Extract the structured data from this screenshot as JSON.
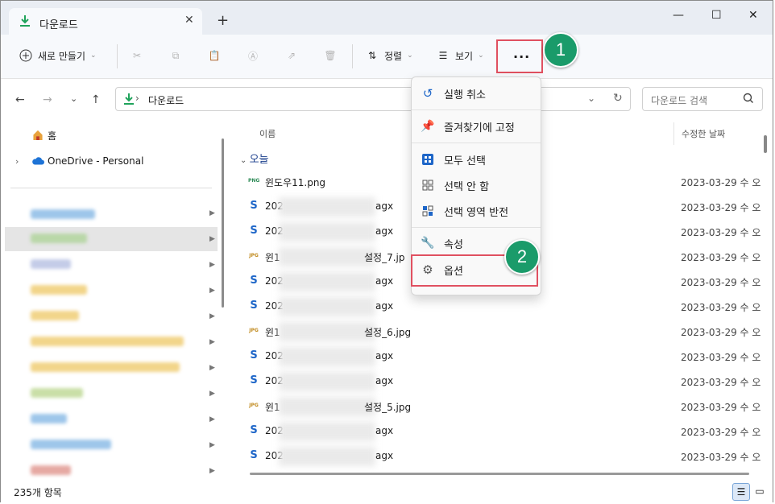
{
  "tab": {
    "title": "다운로드",
    "close": "✕",
    "new": "+"
  },
  "window": {
    "minimize": "—",
    "maximize": "☐",
    "close": "✕"
  },
  "toolbar": {
    "new_label": "새로 만들기",
    "sort_label": "정렬",
    "view_label": "보기",
    "more_label": "···"
  },
  "badges": {
    "one": "1",
    "two": "2"
  },
  "address": {
    "path": "다운로드",
    "sep": "›"
  },
  "search": {
    "placeholder": "다운로드 검색"
  },
  "nav": {
    "home": "홈",
    "onedrive": "OneDrive - Personal"
  },
  "columns": {
    "name": "이름",
    "date": "수정한 날짜"
  },
  "group": {
    "label": "오늘"
  },
  "files": [
    {
      "type": "png",
      "icon": "PNG",
      "prefix": "윈도우11.png",
      "suffix": "",
      "date": "2023-03-29 수 오"
    },
    {
      "type": "s",
      "icon": "S",
      "prefix": "202",
      "suffix": "agx",
      "date": "2023-03-29 수 오"
    },
    {
      "type": "s",
      "icon": "S",
      "prefix": "202",
      "suffix": "agx",
      "date": "2023-03-29 수 오"
    },
    {
      "type": "jpg",
      "icon": "JPG",
      "prefix": "윈1",
      "suffix": "설정_7.jp",
      "date": "2023-03-29 수 오"
    },
    {
      "type": "s",
      "icon": "S",
      "prefix": "202",
      "suffix": "agx",
      "date": "2023-03-29 수 오"
    },
    {
      "type": "s",
      "icon": "S",
      "prefix": "202",
      "suffix": "agx",
      "date": "2023-03-29 수 오"
    },
    {
      "type": "jpg",
      "icon": "JPG",
      "prefix": "윈1",
      "suffix": "설정_6.jpg",
      "date": "2023-03-29 수 오"
    },
    {
      "type": "s",
      "icon": "S",
      "prefix": "202",
      "suffix": "agx",
      "date": "2023-03-29 수 오"
    },
    {
      "type": "s",
      "icon": "S",
      "prefix": "202",
      "suffix": "agx",
      "date": "2023-03-29 수 오"
    },
    {
      "type": "jpg",
      "icon": "JPG",
      "prefix": "윈1",
      "suffix": "설정_5.jpg",
      "date": "2023-03-29 수 오"
    },
    {
      "type": "s",
      "icon": "S",
      "prefix": "202",
      "suffix": "agx",
      "date": "2023-03-29 수 오"
    },
    {
      "type": "s",
      "icon": "S",
      "prefix": "202",
      "suffix": "agx",
      "date": "2023-03-29 수 오"
    }
  ],
  "menu": {
    "undo": "실행 취소",
    "pin": "즐겨찾기에 고정",
    "select_all": "모두 선택",
    "select_none": "선택 안 함",
    "invert": "선택 영역 반전",
    "properties": "속성",
    "options": "옵션"
  },
  "status": {
    "count": "235개 항목"
  },
  "colors": {
    "accent": "#1a9b6a",
    "highlight": "#e05060",
    "folder_green": "#1fa35b",
    "link_blue": "#1a3e8c"
  }
}
